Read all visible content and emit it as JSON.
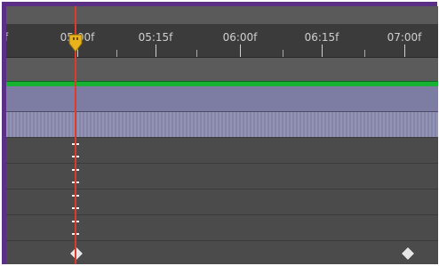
{
  "timeline": {
    "ruler": {
      "ticks": [
        {
          "label": "f"
        },
        {
          "label": "05:00f"
        },
        {
          "label": "05:15f"
        },
        {
          "label": "06:00f"
        },
        {
          "label": "06:15f"
        },
        {
          "label": "07:00f"
        }
      ]
    },
    "colors": {
      "background": "#4a4a4a",
      "ruler": "#3b3b3b",
      "green_bar": "#16b232",
      "layer_bar": "#7d7da3",
      "playhead": "#e03a2b",
      "current_time_marker": "#e8b21a"
    },
    "icons": {
      "current_time_marker": "pin-shaped-marker-icon",
      "hold_keyframe": "i-beam-keyframe-icon",
      "keyframe": "diamond-keyframe-icon"
    }
  }
}
